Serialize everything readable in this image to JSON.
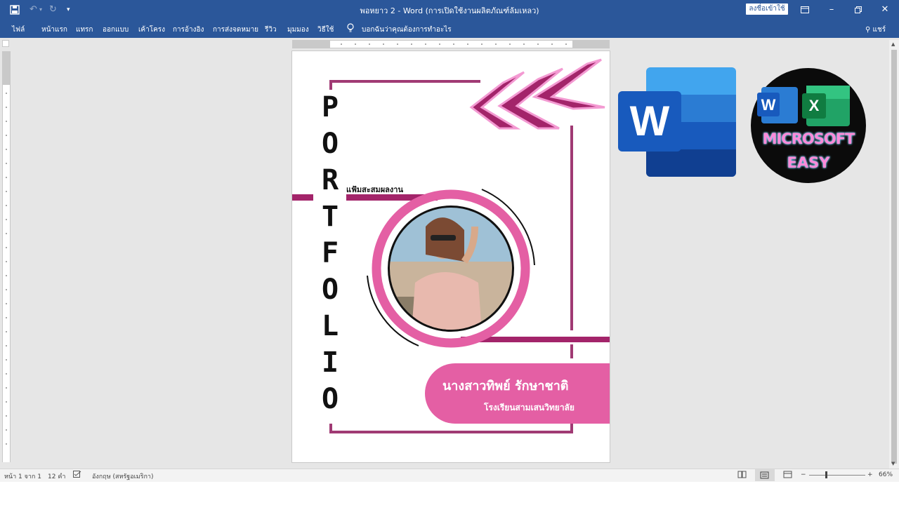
{
  "titlebar": {
    "doc_title": "พอหยาว 2  -  Word (การเปิดใช้งานผลิตภัณฑ์ล้มเหลว)",
    "signin_label": "ลงชื่อเข้าใช้",
    "accent_color": "#2b579a"
  },
  "ribbon": {
    "tabs": [
      "ไฟล์",
      "หน้าแรก",
      "แทรก",
      "ออกแบบ",
      "เค้าโครง",
      "การอ้างอิง",
      "การส่งจดหมาย",
      "รีวิว",
      "มุมมอง",
      "วิธีใช้"
    ],
    "tell_me": "บอกฉันว่าคุณต้องการทำอะไร",
    "share_label": "แชร์"
  },
  "document": {
    "vertical_letters": [
      "P",
      "O",
      "R",
      "T",
      "F",
      "O",
      "L",
      "I",
      "O"
    ],
    "subtitle": "แฟ้มสะสมผลงาน",
    "name": "นางสาวทิพย์   รักษาชาติ",
    "school": "โรงเรียนสามเสนวิทยาลัย",
    "colors": {
      "pink": "#e45fa4",
      "magenta": "#a3246a",
      "frame": "#a03a74"
    }
  },
  "logos": {
    "word_letter": "W",
    "badge_word": "W",
    "badge_excel": "X",
    "badge_line1": "MICROSOFT",
    "badge_line2": "EASY"
  },
  "statusbar": {
    "page": "หน้า 1 จาก 1",
    "words": "12 คำ",
    "language": "อังกฤษ (สหรัฐอเมริกา)",
    "zoom": "66%"
  }
}
